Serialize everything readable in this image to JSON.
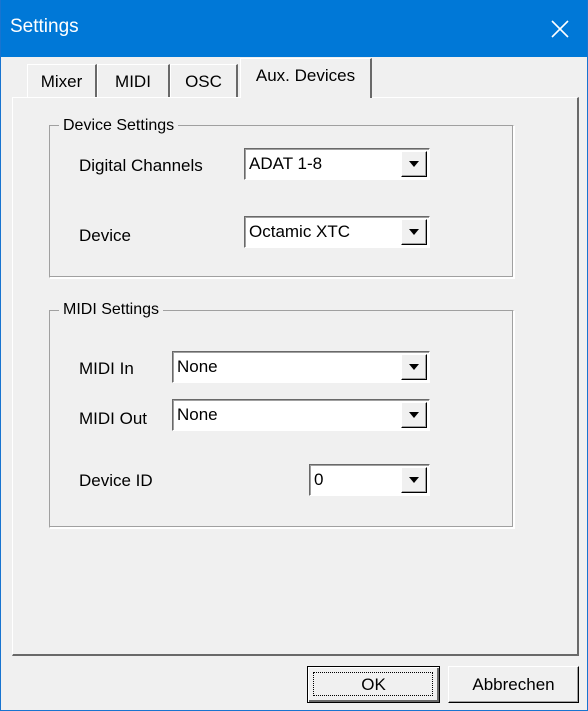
{
  "window": {
    "title": "Settings",
    "close_icon": "close-icon"
  },
  "tabs": [
    {
      "label": "Mixer",
      "active": false
    },
    {
      "label": "MIDI",
      "active": false
    },
    {
      "label": "OSC",
      "active": false
    },
    {
      "label": "Aux. Devices",
      "active": true
    }
  ],
  "device_settings": {
    "group_label": "Device Settings",
    "digital_channels": {
      "label": "Digital Channels",
      "value": "ADAT 1-8"
    },
    "device": {
      "label": "Device",
      "value": "Octamic XTC"
    }
  },
  "midi_settings": {
    "group_label": "MIDI Settings",
    "midi_in": {
      "label": "MIDI In",
      "value": "None"
    },
    "midi_out": {
      "label": "MIDI Out",
      "value": "None"
    },
    "device_id": {
      "label": "Device ID",
      "value": "0"
    }
  },
  "buttons": {
    "ok": "OK",
    "cancel": "Abbrechen"
  },
  "colors": {
    "titlebar": "#0078d7",
    "window_bg": "#f0f0f0"
  }
}
